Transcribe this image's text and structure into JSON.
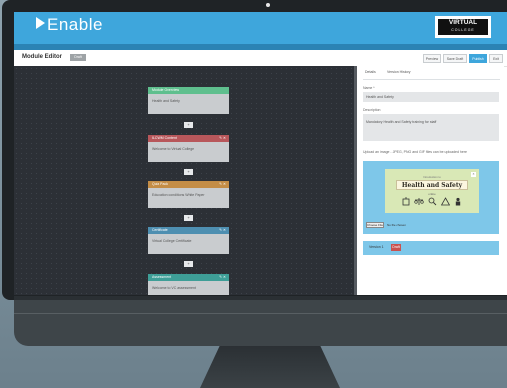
{
  "app": {
    "name": "Enable",
    "brand_main": "VIRTUAL",
    "brand_sub": "COLLEGE"
  },
  "editor": {
    "title": "Module Editor",
    "status_badge": "Draft",
    "buttons": {
      "preview": "Preview",
      "save_draft": "Save Draft",
      "publish": "Publish",
      "exit": "Exit"
    }
  },
  "nodes": [
    {
      "title": "Module Overview",
      "body": "Health and Safety",
      "color": "#5fbf8e",
      "controls": false
    },
    {
      "title": "ILCWM Content",
      "body": "Welcome to Virtual College",
      "color": "#b8575b",
      "controls": true
    },
    {
      "title": "Quiz Pack",
      "body": "Education conditions White Paper",
      "color": "#c48d46",
      "controls": true
    },
    {
      "title": "Certificate",
      "body": "Virtual College Certificate",
      "color": "#4e8fb1",
      "controls": true
    },
    {
      "title": "Assessment",
      "body": "Welcome to VC assessment",
      "color": "#3e9e97",
      "controls": true
    }
  ],
  "panel": {
    "tabs": [
      "Details",
      "Version History"
    ],
    "name_label": "Name *",
    "name_value": "Health and Safety",
    "description_label": "Description",
    "description_value": "Mandatory Health and Safety training for staff",
    "upload_label": "Upload an image - JPEG, PNG and GIF files can be uploaded here",
    "image_preview": {
      "subtitle": "Introduction to",
      "title": "Health and Safety",
      "date_text": "online",
      "icons": [
        "fire-extinguisher-icon",
        "scales-icon",
        "magnifier-icon",
        "warning-icon",
        "person-icon"
      ]
    },
    "choose_file": "Choose File",
    "no_file": "No file chosen",
    "version_label": "Version 1",
    "version_badge": "Draft"
  },
  "colors": {
    "header": "#3ea6dc",
    "canvas": "#2c3036",
    "accent": "#3ea6dc"
  }
}
